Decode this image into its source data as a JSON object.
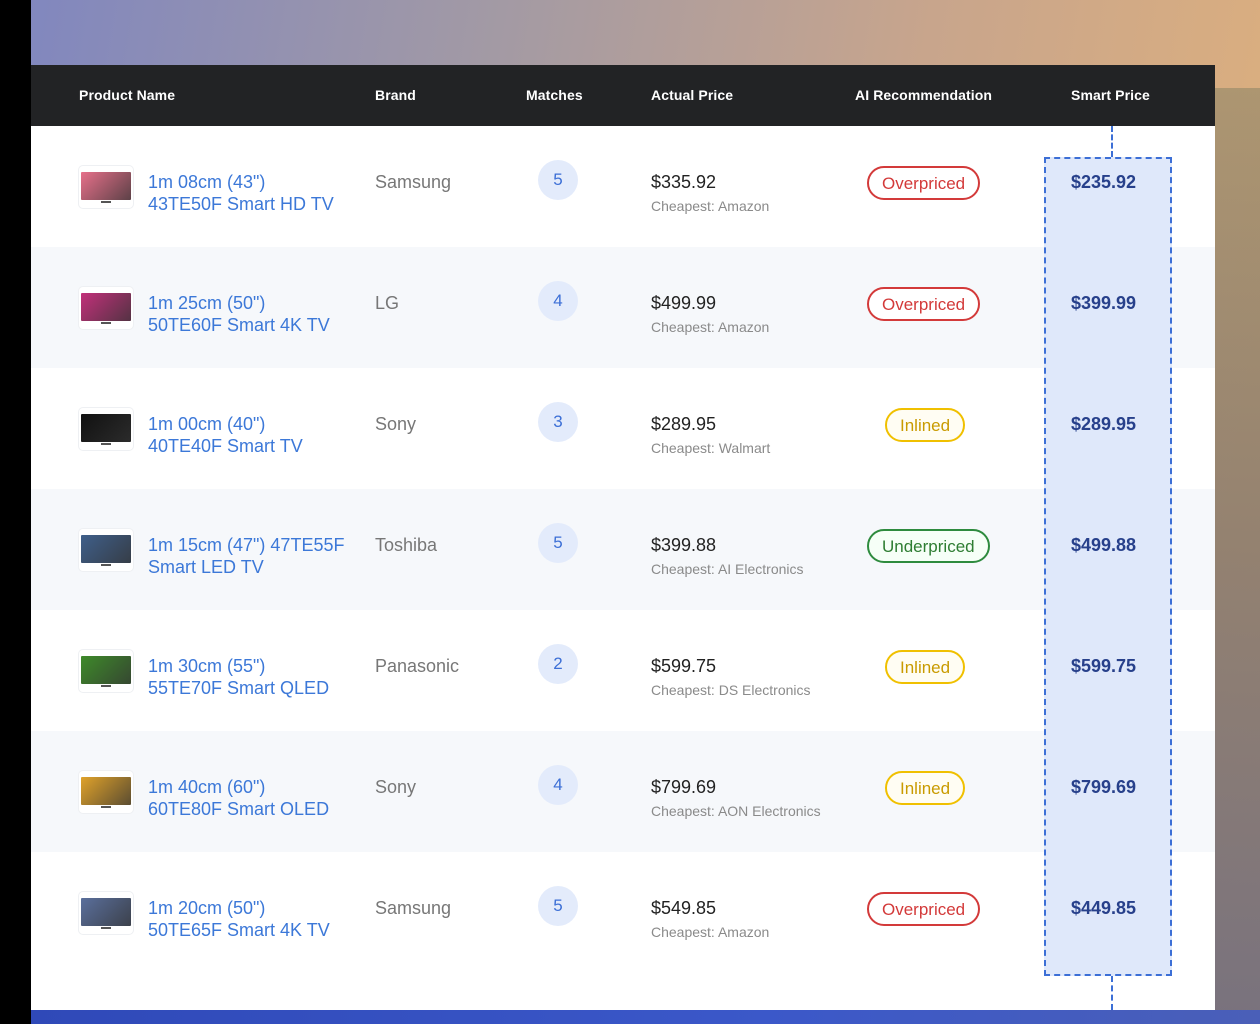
{
  "headers": {
    "product": "Product Name",
    "brand": "Brand",
    "matches": "Matches",
    "actual": "Actual Price",
    "ai": "AI Recommendation",
    "smart": "Smart Price"
  },
  "rows": [
    {
      "name_line1": "1m 08cm (43\")",
      "name_line2": "43TE50F Smart HD TV",
      "brand": "Samsung",
      "matches": "5",
      "price": "$335.92",
      "cheapest": "Cheapest: Amazon",
      "rec": "Overpriced",
      "rec_type": "over",
      "smart": "$235.92",
      "thumb_color": "#e7708a"
    },
    {
      "name_line1": "1m 25cm (50\")",
      "name_line2": "50TE60F Smart 4K TV",
      "brand": "LG",
      "matches": "4",
      "price": "$499.99",
      "cheapest": "Cheapest: Amazon",
      "rec": "Overpriced",
      "rec_type": "over",
      "smart": "$399.99",
      "thumb_color": "#c2307a"
    },
    {
      "name_line1": "1m 00cm (40\")",
      "name_line2": "40TE40F Smart TV",
      "brand": "Sony",
      "matches": "3",
      "price": "$289.95",
      "cheapest": "Cheapest: Walmart",
      "rec": "Inlined",
      "rec_type": "inl",
      "smart": "$289.95",
      "thumb_color": "#111111"
    },
    {
      "name_line1": "1m 15cm (47\") 47TE55F",
      "name_line2": "Smart LED TV",
      "brand": "Toshiba",
      "matches": "5",
      "price": "$399.88",
      "cheapest": "Cheapest: AI Electronics",
      "rec": "Underpriced",
      "rec_type": "under",
      "smart": "$499.88",
      "thumb_color": "#3f5f8a"
    },
    {
      "name_line1": "1m 30cm (55\")",
      "name_line2": "55TE70F Smart QLED",
      "brand": "Panasonic",
      "matches": "2",
      "price": "$599.75",
      "cheapest": "Cheapest: DS Electronics",
      "rec": "Inlined",
      "rec_type": "inl",
      "smart": "$599.75",
      "thumb_color": "#3e8a2a"
    },
    {
      "name_line1": "1m 40cm (60\")",
      "name_line2": "60TE80F Smart OLED",
      "brand": "Sony",
      "matches": "4",
      "price": "$799.69",
      "cheapest": "Cheapest: AON Electronics",
      "rec": "Inlined",
      "rec_type": "inl",
      "smart": "$799.69",
      "thumb_color": "#e0a22a"
    },
    {
      "name_line1": "1m 20cm (50\")",
      "name_line2": "50TE65F Smart 4K TV",
      "brand": "Samsung",
      "matches": "5",
      "price": "$549.85",
      "cheapest": "Cheapest: Amazon",
      "rec": "Overpriced",
      "rec_type": "over",
      "smart": "$449.85",
      "thumb_color": "#5a6f9c"
    }
  ]
}
